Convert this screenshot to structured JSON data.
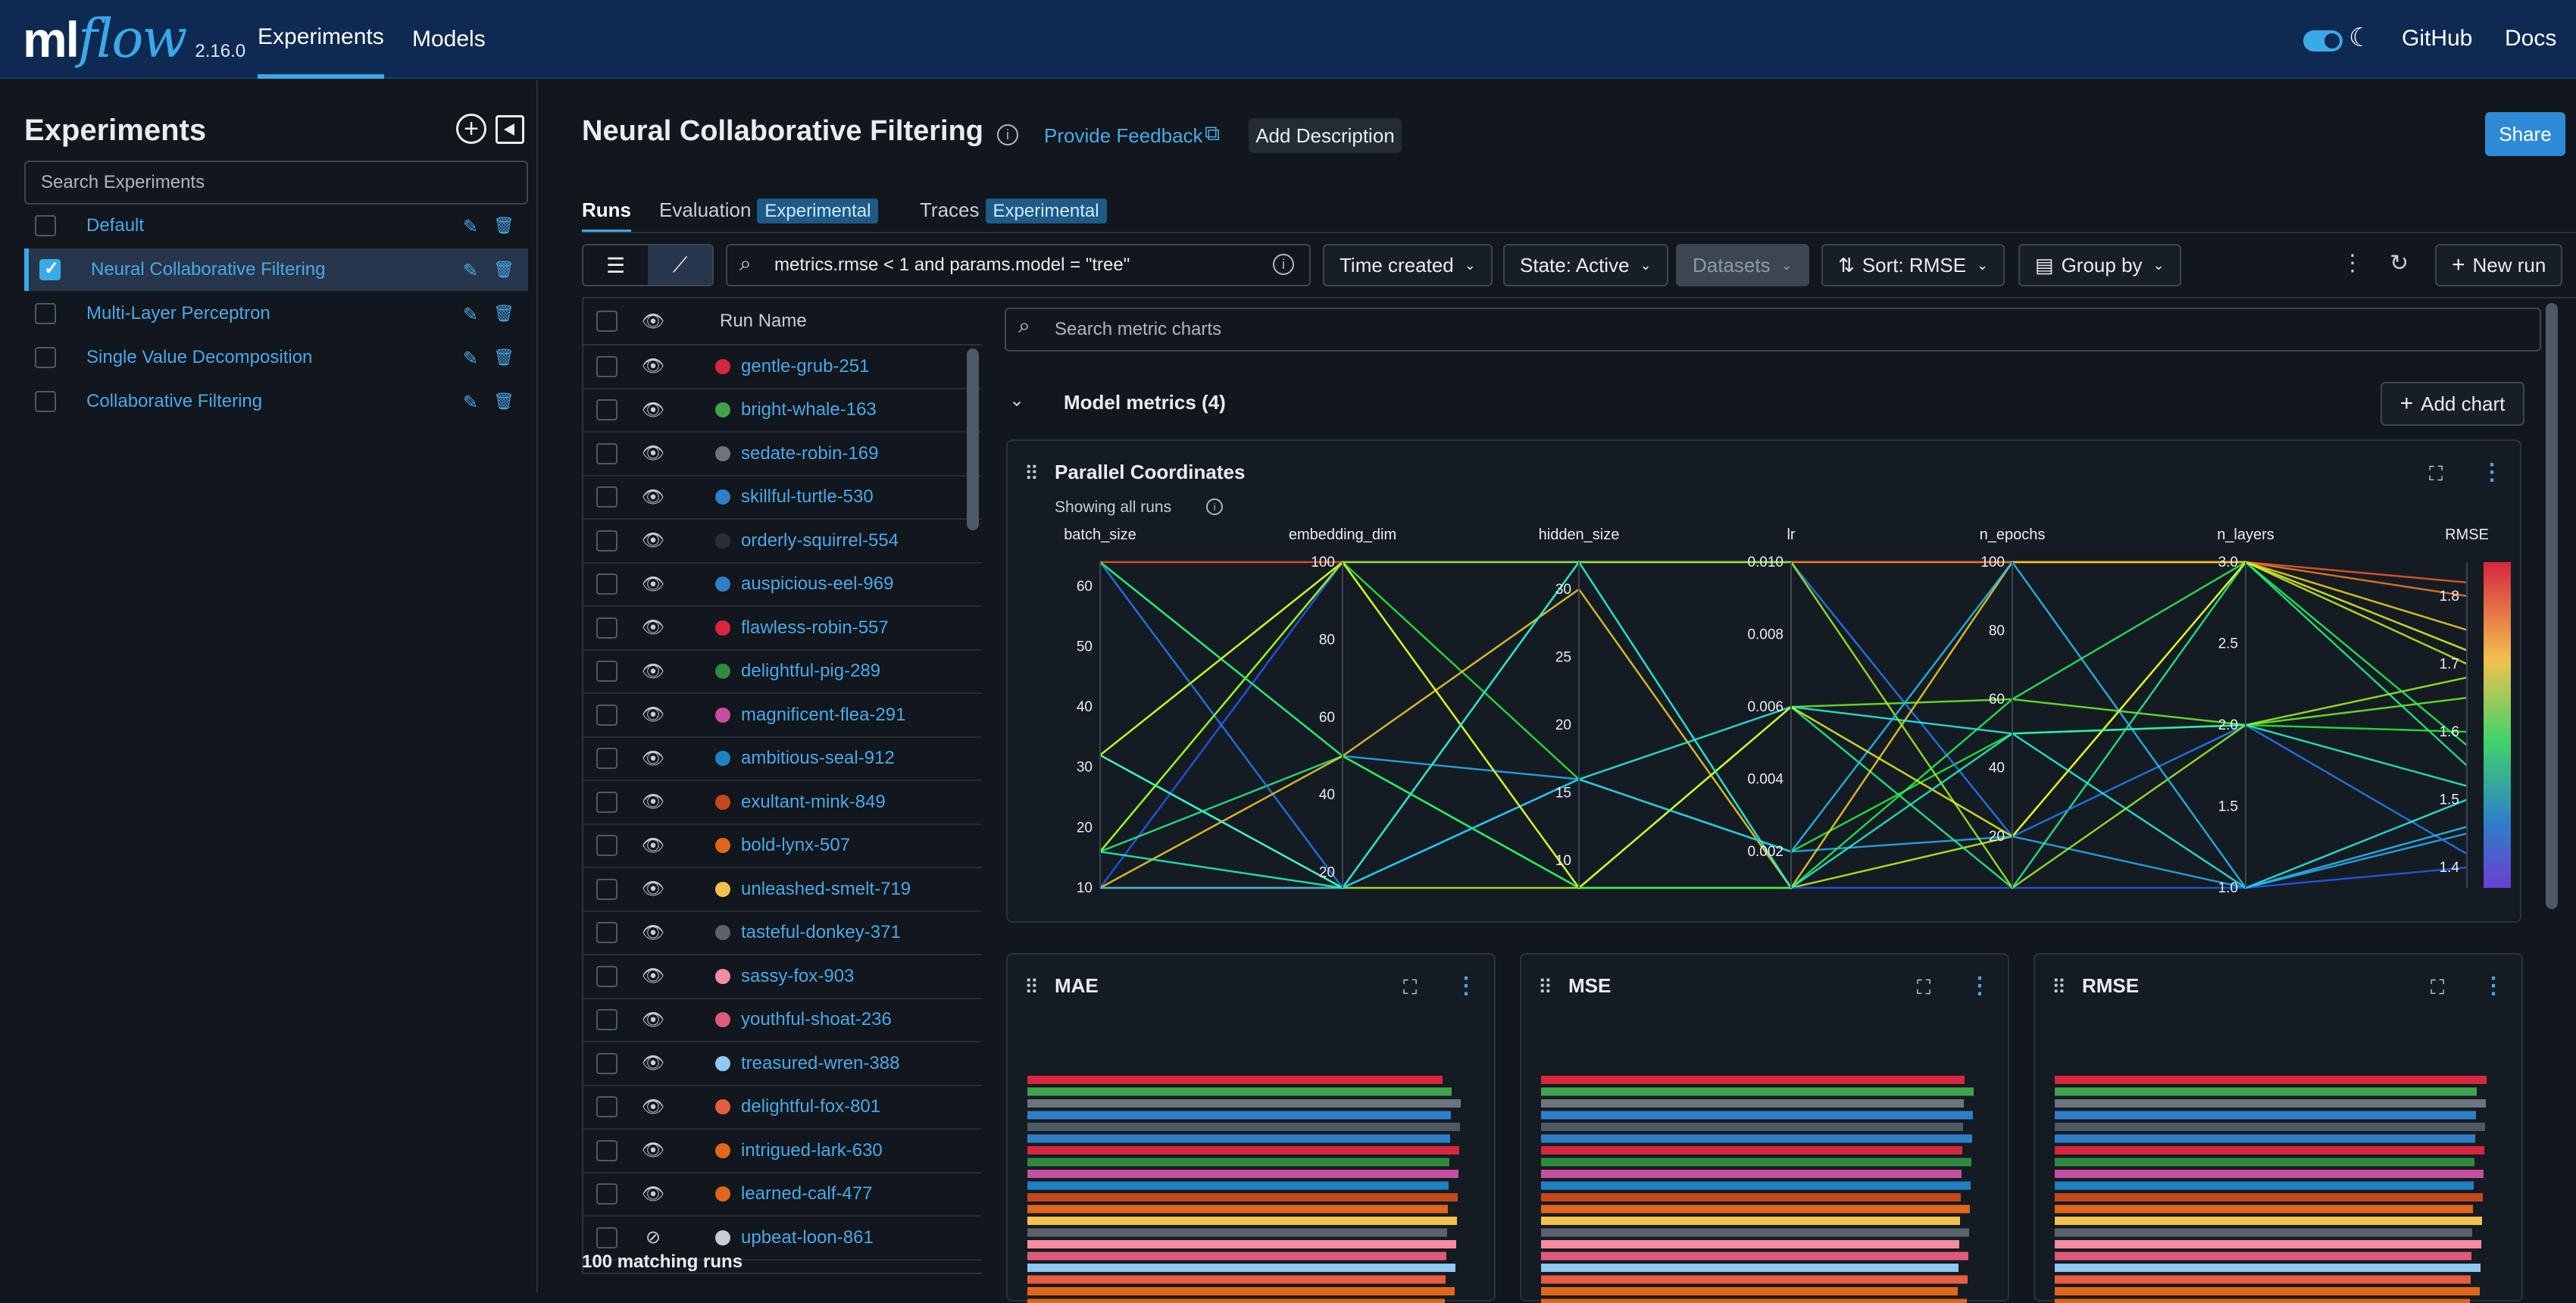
{
  "topbar": {
    "logo_ml": "ml",
    "logo_flow": "flow",
    "version": "2.16.0",
    "nav": [
      "Experiments",
      "Models"
    ],
    "links": [
      "GitHub",
      "Docs"
    ]
  },
  "sidebar": {
    "title": "Experiments",
    "search_placeholder": "Search Experiments",
    "items": [
      {
        "label": "Default",
        "selected": false
      },
      {
        "label": "Neural Collaborative Filtering",
        "selected": true
      },
      {
        "label": "Multi-Layer Perceptron",
        "selected": false
      },
      {
        "label": "Single Value Decomposition",
        "selected": false
      },
      {
        "label": "Collaborative Filtering",
        "selected": false
      }
    ]
  },
  "header": {
    "title": "Neural Collaborative Filtering",
    "feedback": "Provide Feedback",
    "add_description": "Add Description",
    "share": "Share"
  },
  "tabs": [
    {
      "label": "Runs",
      "tag": ""
    },
    {
      "label": "Evaluation",
      "tag": "Experimental"
    },
    {
      "label": "Traces",
      "tag": "Experimental"
    }
  ],
  "toolbar": {
    "search_value": "metrics.rmse < 1 and params.model = \"tree\"",
    "time_created": "Time created",
    "state": "State: Active",
    "datasets": "Datasets",
    "sort": "Sort: RMSE",
    "group_by": "Group by",
    "new_run": "New run"
  },
  "runs_table": {
    "column_header": "Run Name",
    "rows": [
      {
        "name": "gentle-grub-251",
        "color": "#d7263d"
      },
      {
        "name": "bright-whale-163",
        "color": "#3fa34d"
      },
      {
        "name": "sedate-robin-169",
        "color": "#6c757d"
      },
      {
        "name": "skillful-turtle-530",
        "color": "#2f7fc8"
      },
      {
        "name": "orderly-squirrel-554",
        "color": "#2a2f36"
      },
      {
        "name": "auspicious-eel-969",
        "color": "#2f7fc8"
      },
      {
        "name": "flawless-robin-557",
        "color": "#d7263d"
      },
      {
        "name": "delightful-pig-289",
        "color": "#2e8b3e"
      },
      {
        "name": "magnificent-flea-291",
        "color": "#c74ea0"
      },
      {
        "name": "ambitious-seal-912",
        "color": "#1f80c4"
      },
      {
        "name": "exultant-mink-849",
        "color": "#c4481c"
      },
      {
        "name": "bold-lynx-507",
        "color": "#e0661b"
      },
      {
        "name": "unleashed-smelt-719",
        "color": "#f2c14e"
      },
      {
        "name": "tasteful-donkey-371",
        "color": "#5a636d"
      },
      {
        "name": "sassy-fox-903",
        "color": "#f58ca0"
      },
      {
        "name": "youthful-shoat-236",
        "color": "#e05a7a"
      },
      {
        "name": "treasured-wren-388",
        "color": "#8fc8f0"
      },
      {
        "name": "delightful-fox-801",
        "color": "#e85d3f"
      },
      {
        "name": "intrigued-lark-630",
        "color": "#e0661b"
      },
      {
        "name": "learned-calf-477",
        "color": "#e0661b"
      },
      {
        "name": "upbeat-loon-861",
        "color": "#c7cfd6",
        "hidden": true
      }
    ],
    "matching": "100 matching runs"
  },
  "charts": {
    "search_placeholder": "Search metric charts",
    "section_title": "Model metrics (4)",
    "add_chart": "Add chart",
    "parallel": {
      "title": "Parallel Coordinates",
      "subtitle": "Showing all runs"
    },
    "bar_titles": [
      "MAE",
      "MSE",
      "RMSE"
    ]
  },
  "chart_data": [
    {
      "type": "parallel_coordinates",
      "title": "Parallel Coordinates",
      "axes": [
        {
          "name": "batch_size",
          "ticks": [
            "60",
            "50",
            "40",
            "30",
            "20",
            "10"
          ],
          "range": [
            10,
            64
          ]
        },
        {
          "name": "embedding_dim",
          "ticks": [
            "100",
            "80",
            "60",
            "40",
            "20"
          ],
          "range": [
            16,
            100
          ]
        },
        {
          "name": "hidden_size",
          "ticks": [
            "30",
            "25",
            "20",
            "15",
            "10"
          ],
          "range": [
            8,
            32
          ]
        },
        {
          "name": "lr",
          "ticks": [
            "0.010",
            "0.008",
            "0.006",
            "0.004",
            "0.002"
          ],
          "range": [
            0.001,
            0.01
          ]
        },
        {
          "name": "n_epochs",
          "ticks": [
            "100",
            "80",
            "60",
            "40",
            "20"
          ],
          "range": [
            5,
            100
          ]
        },
        {
          "name": "n_layers",
          "ticks": [
            "3.0",
            "2.5",
            "2.0",
            "1.5",
            "1.0"
          ],
          "range": [
            1,
            3
          ]
        },
        {
          "name": "RMSE",
          "ticks": [
            "1.8",
            "1.7",
            "1.6",
            "1.5",
            "1.4"
          ],
          "range": [
            1.37,
            1.85
          ]
        }
      ],
      "lines": [
        [
          64,
          100,
          32,
          0.01,
          100,
          3,
          1.82
        ],
        [
          10,
          16,
          32,
          0.01,
          100,
          3,
          1.8
        ],
        [
          32,
          16,
          8,
          0.001,
          20,
          3,
          1.7
        ],
        [
          16,
          100,
          8,
          0.006,
          60,
          2,
          1.65
        ],
        [
          64,
          50,
          16,
          0.002,
          20,
          1,
          1.45
        ],
        [
          10,
          100,
          32,
          0.001,
          5,
          1,
          1.4
        ],
        [
          16,
          50,
          8,
          0.006,
          5,
          3,
          1.55
        ],
        [
          32,
          100,
          16,
          0.002,
          50,
          2,
          1.6
        ],
        [
          64,
          16,
          32,
          0.01,
          20,
          2,
          1.42
        ],
        [
          10,
          50,
          30,
          0.001,
          100,
          3,
          1.75
        ],
        [
          32,
          16,
          16,
          0.006,
          50,
          1,
          1.5
        ],
        [
          16,
          100,
          32,
          0.01,
          5,
          2,
          1.68
        ],
        [
          64,
          50,
          8,
          0.001,
          60,
          3,
          1.58
        ],
        [
          10,
          16,
          16,
          0.002,
          100,
          1,
          1.46
        ],
        [
          32,
          100,
          8,
          0.006,
          20,
          3,
          1.72
        ],
        [
          16,
          16,
          32,
          0.001,
          50,
          2,
          1.52
        ]
      ]
    }
  ]
}
